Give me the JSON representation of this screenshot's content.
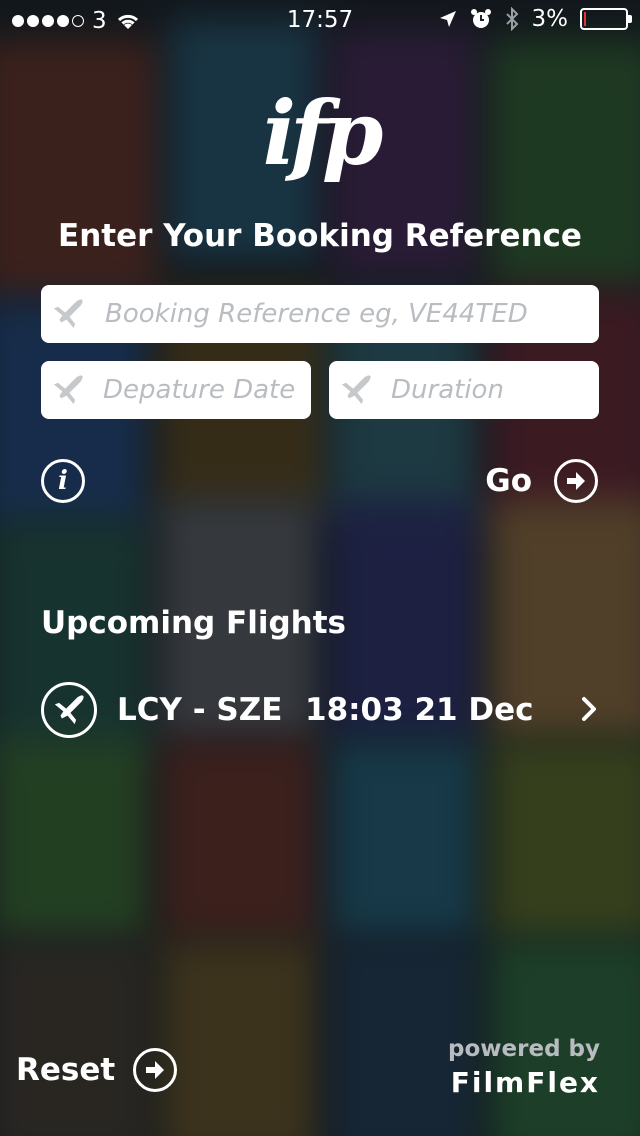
{
  "status_bar": {
    "carrier": "3",
    "time": "17:57",
    "battery": "3%",
    "battery_level": 0.03
  },
  "logo": {
    "text": "ifp"
  },
  "booking": {
    "title": "Enter Your Booking Reference",
    "reference_placeholder": "Booking Reference   eg, VE44TED",
    "date_placeholder": "Depature Date",
    "duration_placeholder": "Duration"
  },
  "actions": {
    "info_label": "i",
    "go_label": "Go",
    "reset_label": "Reset"
  },
  "upcoming": {
    "title": "Upcoming Flights",
    "flights": [
      {
        "route": "LCY - SZE",
        "when": "18:03 21 Dec"
      }
    ]
  },
  "footer": {
    "powered_by": "powered by",
    "brand": "FilmFlex"
  },
  "colors": {
    "background": "#1d2329",
    "field_bg": "#ffffff",
    "placeholder": "#b9bdc1",
    "battery_low": "#e33333"
  },
  "icons": {
    "plane": "airplane-icon",
    "info": "info-icon",
    "arrow": "arrow-right-circle-icon",
    "chevron": "chevron-right-icon"
  }
}
